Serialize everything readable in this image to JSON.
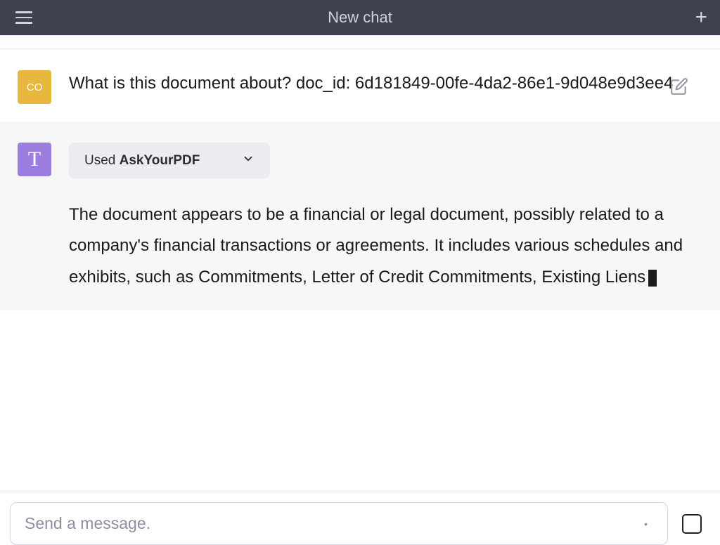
{
  "header": {
    "title": "New chat"
  },
  "user_message": {
    "avatar_label": "CO",
    "text": "What is this document about? doc_id: 6d181849-00fe-4da2-86e1-9d048e9d3ee4"
  },
  "assistant_message": {
    "avatar_label": "T",
    "plugin": {
      "prefix": "Used ",
      "name": "AskYourPDF"
    },
    "text": "The document appears to be a financial or legal document, possibly related to a company's financial transactions or agreements. It includes various schedules and exhibits, such as Commitments, Letter of Credit Commitments, Existing Liens"
  },
  "input": {
    "placeholder": "Send a message."
  },
  "colors": {
    "header_bg": "#40414f",
    "user_avatar": "#e8b83e",
    "assistant_avatar": "#9b7ede",
    "assistant_bg": "#f7f7f8",
    "plugin_pill_bg": "#ececf1"
  }
}
